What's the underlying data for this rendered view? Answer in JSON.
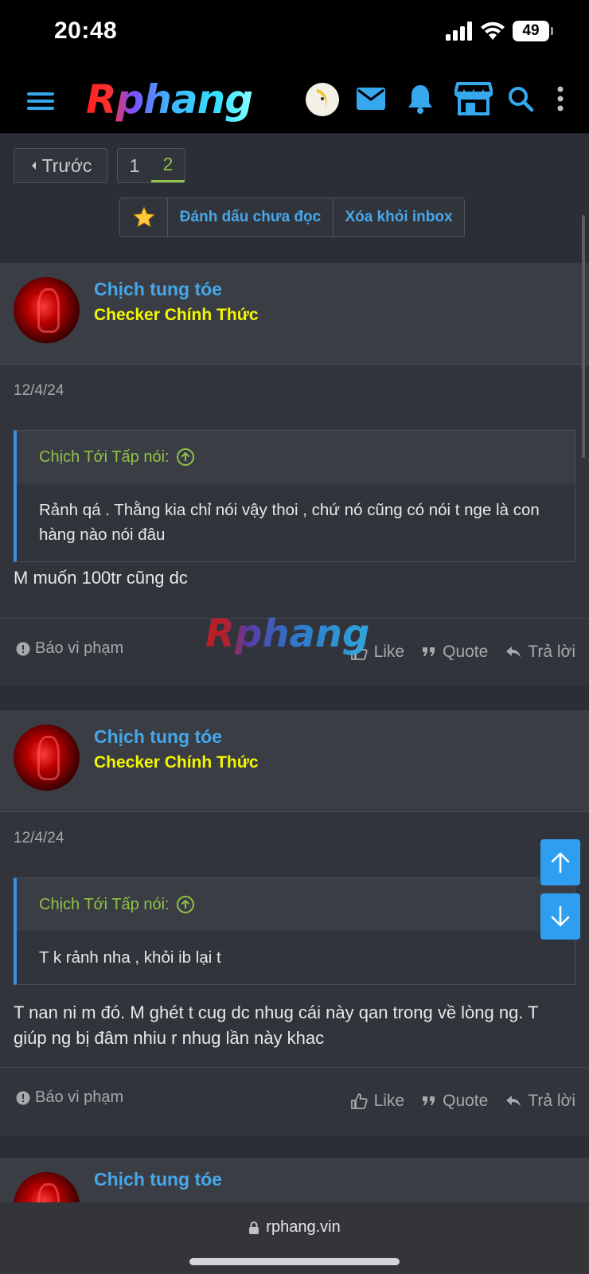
{
  "status": {
    "time": "20:48",
    "battery": "49"
  },
  "header": {
    "logo": "Rphang"
  },
  "pagination": {
    "prev": "Trước",
    "pages": [
      "1",
      "2"
    ],
    "active": "2"
  },
  "actions": {
    "mark_unread": "Đánh dấu chưa đọc",
    "remove_inbox": "Xóa khỏi inbox"
  },
  "posts": [
    {
      "author": "Chịch tung tóe",
      "user_title": "Checker Chính Thức",
      "date": "12/4/24",
      "quote_author": "Chịch Tới Tấp nói:",
      "quote_text": "Rảnh qá . Thằng kia chỉ nói vậy thoi , chứ nó cũng có nói t nge là con hàng nào nói đâu",
      "text": "M muốn 100tr cũng dc",
      "report": "Báo vi phạm",
      "like": "Like",
      "quote": "Quote",
      "reply": "Trả lời"
    },
    {
      "author": "Chịch tung tóe",
      "user_title": "Checker Chính Thức",
      "date": "12/4/24",
      "quote_author": "Chịch Tới Tấp nói:",
      "quote_text": "T k rảnh nha , khỏi ib lại t",
      "text": "T nan ni m đó. M ghét t cug dc nhug cái này qan trong về lòng ng. T giúp ng bị đâm nhiu r nhug lần này khac",
      "report": "Báo vi phạm",
      "like": "Like",
      "quote": "Quote",
      "reply": "Trả lời"
    },
    {
      "author": "Chịch tung tóe"
    }
  ],
  "watermark": "Rphang",
  "browser": {
    "url": "rphang.vin"
  },
  "colors": {
    "accent": "#47a7eb",
    "user_title": "#f4f700",
    "quote_green": "#8fc346",
    "float_button": "#2e9ff0"
  }
}
